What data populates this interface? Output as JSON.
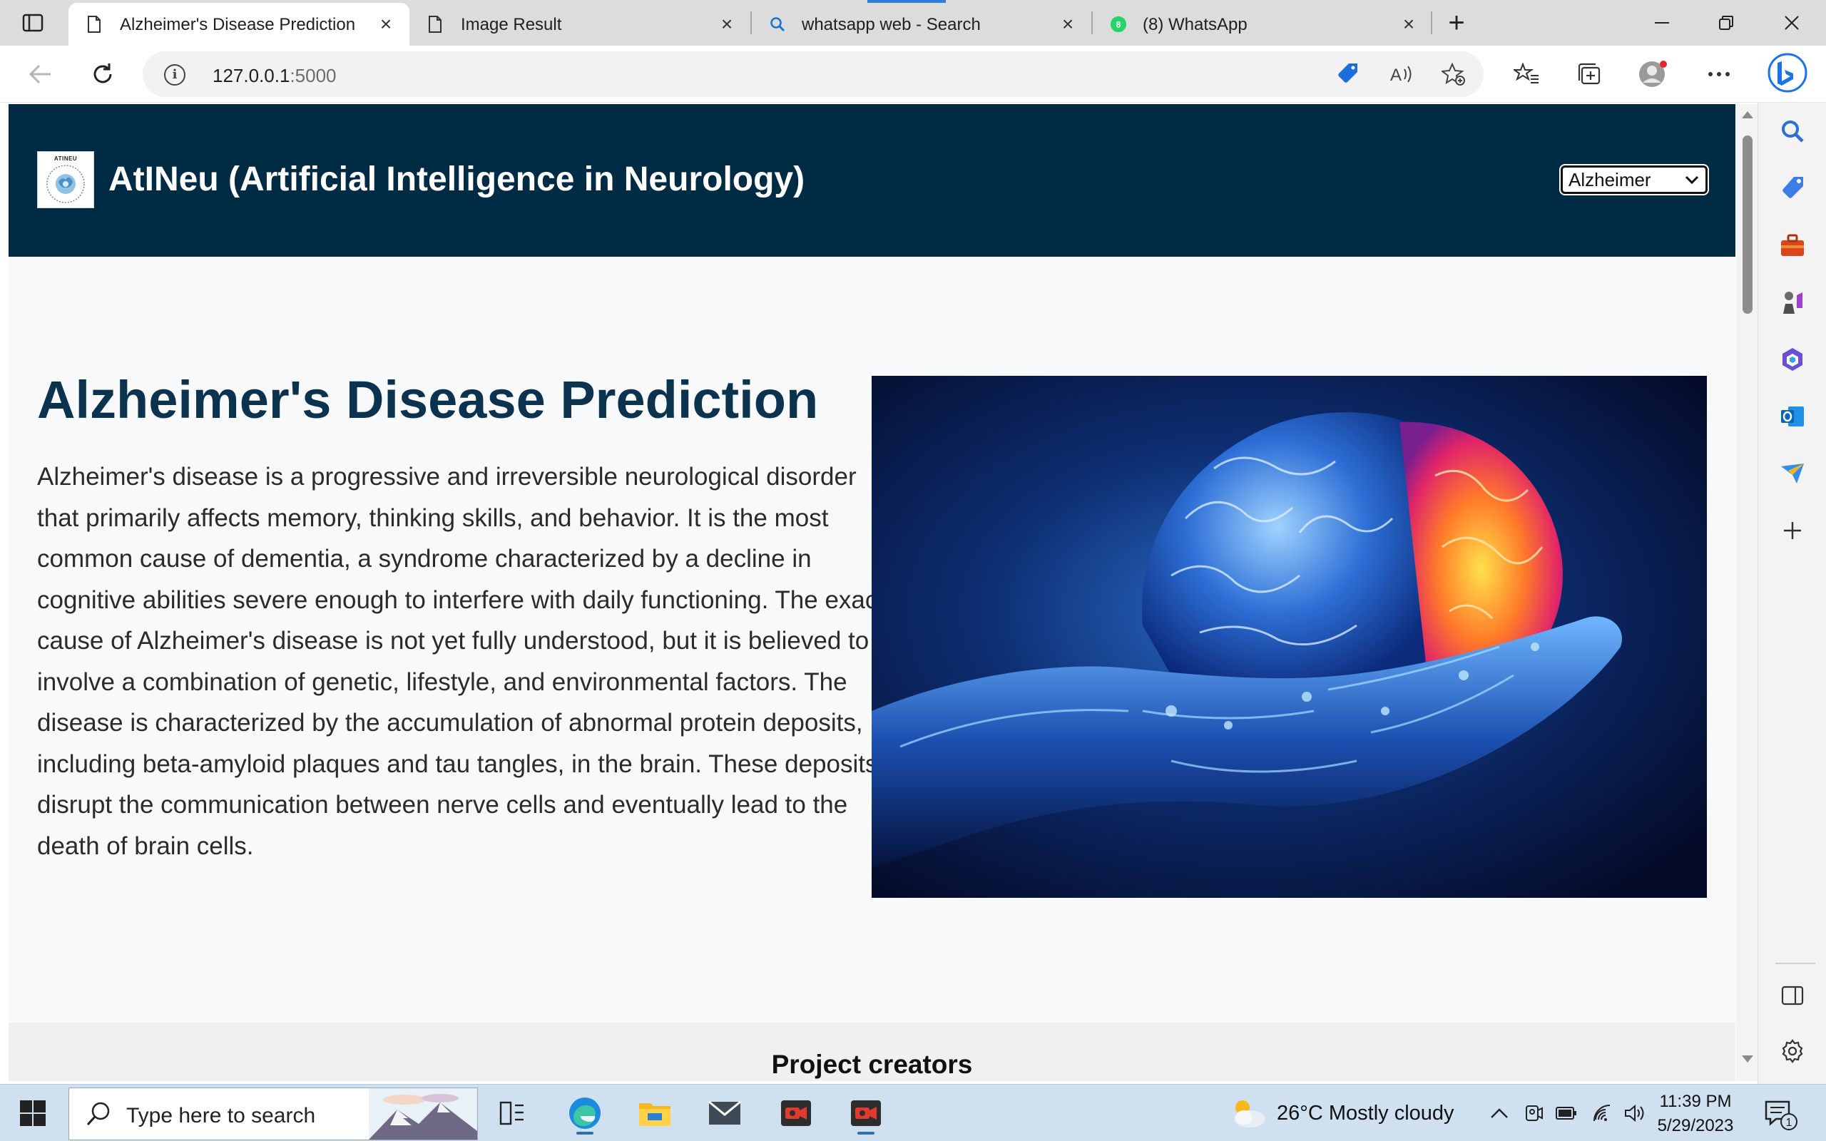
{
  "browser": {
    "tabs": [
      {
        "title": "Alzheimer's Disease Prediction",
        "active": true
      },
      {
        "title": "Image Result",
        "active": false
      },
      {
        "title": "whatsapp web - Search",
        "active": false
      },
      {
        "title": "(8) WhatsApp",
        "active": false,
        "badge": "8"
      }
    ],
    "address": {
      "host": "127.0.0.1",
      "port": ":5000"
    }
  },
  "site": {
    "title": "AtINeu (Artificial Intelligence in Neurology)",
    "logo_text": "ATINEU",
    "select_value": "Alzheimer",
    "heading": "Alzheimer's Disease Prediction",
    "description": "Alzheimer's disease is a progressive and irreversible neurological disorder that primarily affects memory, thinking skills, and behavior. It is the most common cause of dementia, a syndrome characterized by a decline in cognitive abilities severe enough to interfere with daily functioning. The exact cause of Alzheimer's disease is not yet fully understood, but it is believed to involve a combination of genetic, lifestyle, and environmental factors. The disease is characterized by the accumulation of abnormal protein deposits, including beta-amyloid plaques and tau tangles, in the brain. These deposits disrupt the communication between nerve cells and eventually lead to the death of brain cells.",
    "creators_title": "Project creators"
  },
  "taskbar": {
    "search_placeholder": "Type here to search",
    "weather": "26°C  Mostly cloudy",
    "time": "11:39 PM",
    "date": "5/29/2023",
    "notification_count": "1"
  },
  "colors": {
    "header_bg": "#002b45",
    "heading": "#0b3350",
    "page_bg": "#f8f9fa",
    "whatsapp": "#25d366",
    "bing": "#1b73e8"
  }
}
